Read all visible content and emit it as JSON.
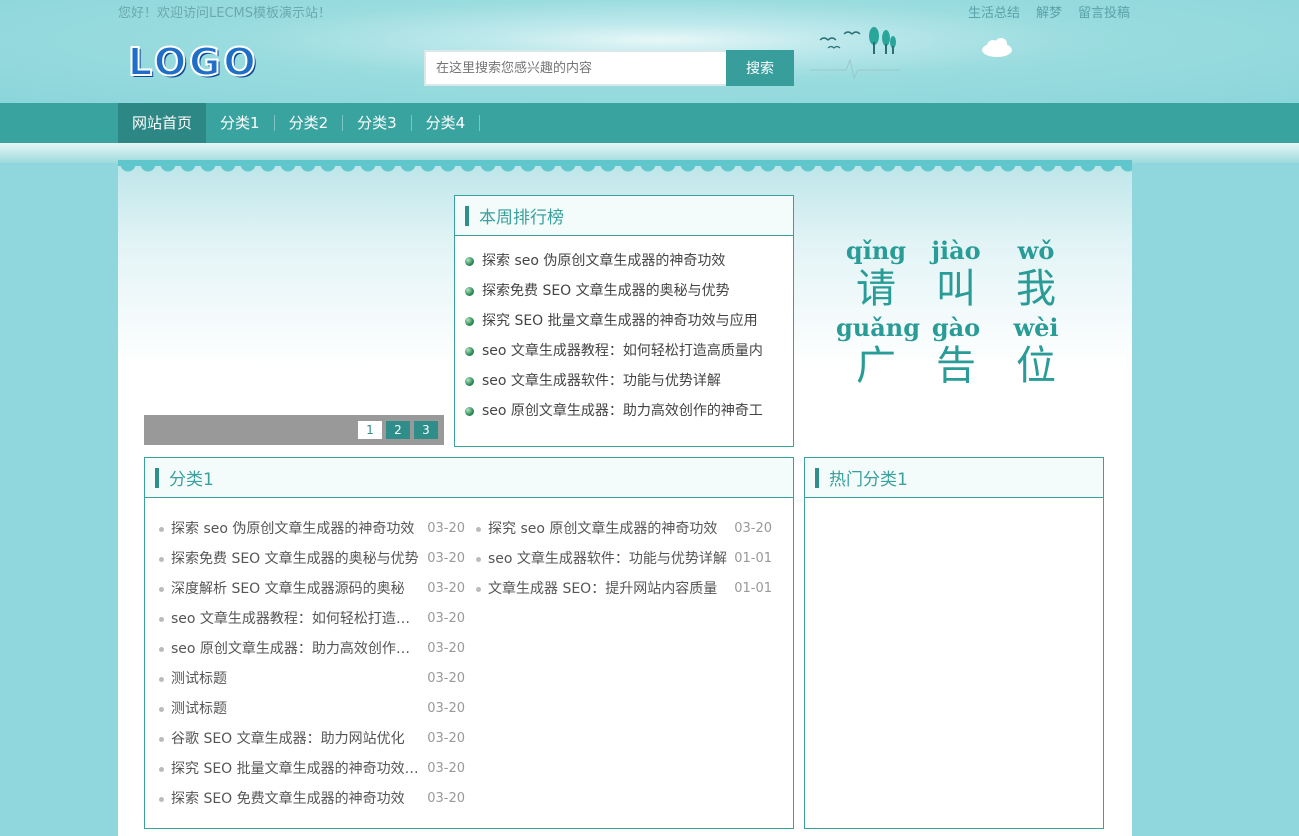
{
  "topbar": {
    "welcome": "您好！欢迎访问LECMS模板演示站！",
    "links": [
      "生活总结",
      "解梦",
      "留言投稿"
    ]
  },
  "logo": "LOGO",
  "search": {
    "placeholder": "在这里搜索您感兴趣的内容",
    "button": "搜索"
  },
  "nav": {
    "items": [
      {
        "label": "网站首页",
        "active": true
      },
      {
        "label": "分类1"
      },
      {
        "label": "分类2"
      },
      {
        "label": "分类3"
      },
      {
        "label": "分类4"
      }
    ]
  },
  "slider": {
    "pages": [
      "1",
      "2",
      "3"
    ],
    "current": "1"
  },
  "rank": {
    "title": "本周排行榜",
    "items": [
      "探索 seo 伪原创文章生成器的神奇功效",
      "探索免费 SEO 文章生成器的奥秘与优势",
      "探究 SEO 批量文章生成器的神奇功效与应用",
      "seo 文章生成器教程：如何轻松打造高质量内",
      "seo 文章生成器软件：功能与优势详解",
      "seo 原创文章生成器：助力高效创作的神奇工"
    ]
  },
  "ad": {
    "pinyin1": [
      "qǐng",
      "jiào",
      "wǒ"
    ],
    "hanzi1": [
      "请",
      "叫",
      "我"
    ],
    "pinyin2": [
      "guǎng",
      "gào",
      "wèi"
    ],
    "hanzi2": [
      "广",
      "告",
      "位"
    ]
  },
  "cat1": {
    "title": "分类1",
    "left": [
      {
        "title": "探索 seo 伪原创文章生成器的神奇功效",
        "date": "03-20"
      },
      {
        "title": "探索免费 SEO 文章生成器的奥秘与优势",
        "date": "03-20"
      },
      {
        "title": "深度解析 SEO 文章生成器源码的奥秘",
        "date": "03-20"
      },
      {
        "title": "seo 文章生成器教程：如何轻松打造高质量内容",
        "date": "03-20"
      },
      {
        "title": "seo 原创文章生成器：助力高效创作的神奇工具",
        "date": "03-20"
      },
      {
        "title": "测试标题",
        "date": "03-20"
      },
      {
        "title": "测试标题",
        "date": "03-20"
      },
      {
        "title": "谷歌 SEO 文章生成器：助力网站优化",
        "date": "03-20"
      },
      {
        "title": "探究 SEO 批量文章生成器的神奇功效与应用",
        "date": "03-20"
      },
      {
        "title": "探索 SEO 免费文章生成器的神奇功效",
        "date": "03-20"
      }
    ],
    "right": [
      {
        "title": "探究 seo 原创文章生成器的神奇功效",
        "date": "03-20"
      },
      {
        "title": "seo 文章生成器软件：功能与优势详解",
        "date": "01-01"
      },
      {
        "title": "文章生成器 SEO：提升网站内容质量",
        "date": "01-01"
      }
    ]
  },
  "hot": {
    "title": "热门分类1"
  },
  "colors": {
    "nav": "#39a3a0",
    "accent": "#3aa09d",
    "bg": "#8fd7dc"
  }
}
